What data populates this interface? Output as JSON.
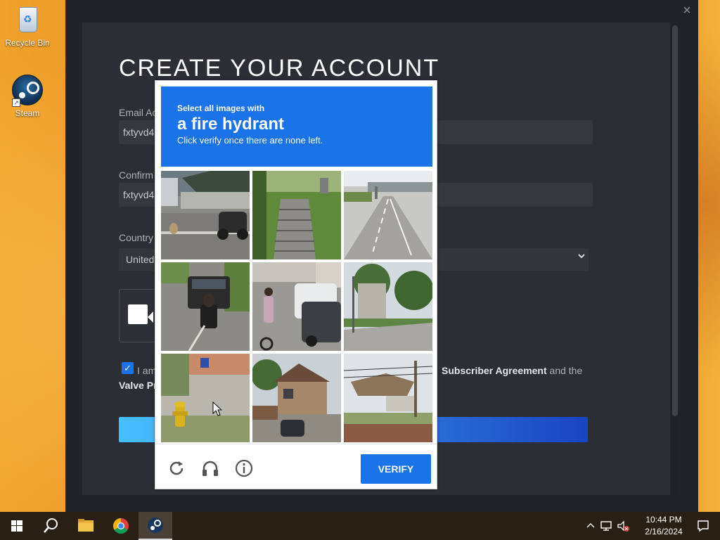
{
  "desktop": {
    "icons": [
      {
        "label": "Recycle Bin"
      },
      {
        "label": "Steam"
      }
    ]
  },
  "steam_window": {
    "close_glyph": "×",
    "title": "CREATE YOUR ACCOUNT",
    "email": {
      "label": "Email Ac",
      "value": "fxtyvd4"
    },
    "confirm": {
      "label": "Confirm",
      "value": "fxtyvd4"
    },
    "country": {
      "label": "Country",
      "value": "United"
    },
    "agree": {
      "text_left": "I am",
      "text_right_link": "Subscriber Agreement",
      "text_right_tail": "and the",
      "text_line2": "Valve Pr"
    }
  },
  "captcha": {
    "header": {
      "line1": "Select all images with",
      "line2": "a fire hydrant",
      "line3": "Click verify once there are none left."
    },
    "tiles": [
      {
        "scene": "street with motorcycle"
      },
      {
        "scene": "stairs on grassy hill"
      },
      {
        "scene": "highway with overpass"
      },
      {
        "scene": "road with pickup truck and scooter"
      },
      {
        "scene": "cyclist next to cars"
      },
      {
        "scene": "sidewalk with trees"
      },
      {
        "scene": "fire hydrant on lawn"
      },
      {
        "scene": "house with driveway"
      },
      {
        "scene": "building with utility poles"
      }
    ],
    "icons": [
      "reload-icon",
      "headphones-icon",
      "info-icon"
    ],
    "verify_label": "VERIFY",
    "colors": {
      "accent": "#1a73e8"
    }
  },
  "taskbar": {
    "clock_time": "10:44 PM",
    "clock_date": "2/16/2024"
  }
}
